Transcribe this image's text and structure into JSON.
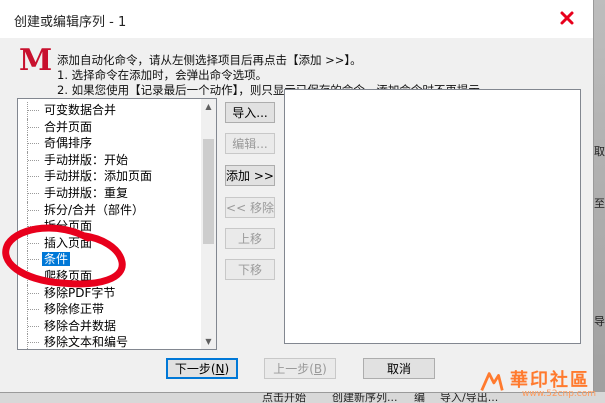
{
  "window": {
    "title": "创建或编辑序列 - 1"
  },
  "logo": {
    "letter": "M"
  },
  "instructions": [
    "添加自动化命令，请从左侧选择项目后再点击【添加 >>】。",
    "1. 选择命令在添加时，会弹出命令选项。",
    "2. 如果您使用【记录最后一个动作】，则只显示已保存的命令，添加命令时不再提示."
  ],
  "command_list": {
    "items": [
      "可变数据合并",
      "合并页面",
      "奇偶排序",
      "手动拼版：开始",
      "手动拼版：添加页面",
      "手动拼版：重复",
      "拆分/合并（部件）",
      "拆分页面",
      "插入页面",
      "条件",
      "爬移页面",
      "移除PDF字节",
      "移除修正带",
      "移除合并数据",
      "移除文本和编号",
      "移除注释标记"
    ],
    "selected_index": 9
  },
  "buttons": {
    "import": "导入...",
    "edit": "编辑...",
    "add": "添加 >>",
    "remove": "<< 移除",
    "move_up": "上移",
    "move_down": "下移",
    "next": "下一步",
    "next_key": "N",
    "prev": "上一步",
    "prev_key": "B",
    "cancel": "取消"
  },
  "background_fragments": {
    "right": [
      "取",
      "至",
      "导"
    ],
    "bottom": [
      "点击开始",
      "创建新序列...",
      "编",
      "导入/导出..."
    ]
  },
  "watermark": {
    "text": "華印社區",
    "url": "www.52cnp.com"
  },
  "colors": {
    "logo": "#c8102e",
    "selection": "#0078d7",
    "annotation": "#e8001c",
    "close": "#e8001c"
  }
}
